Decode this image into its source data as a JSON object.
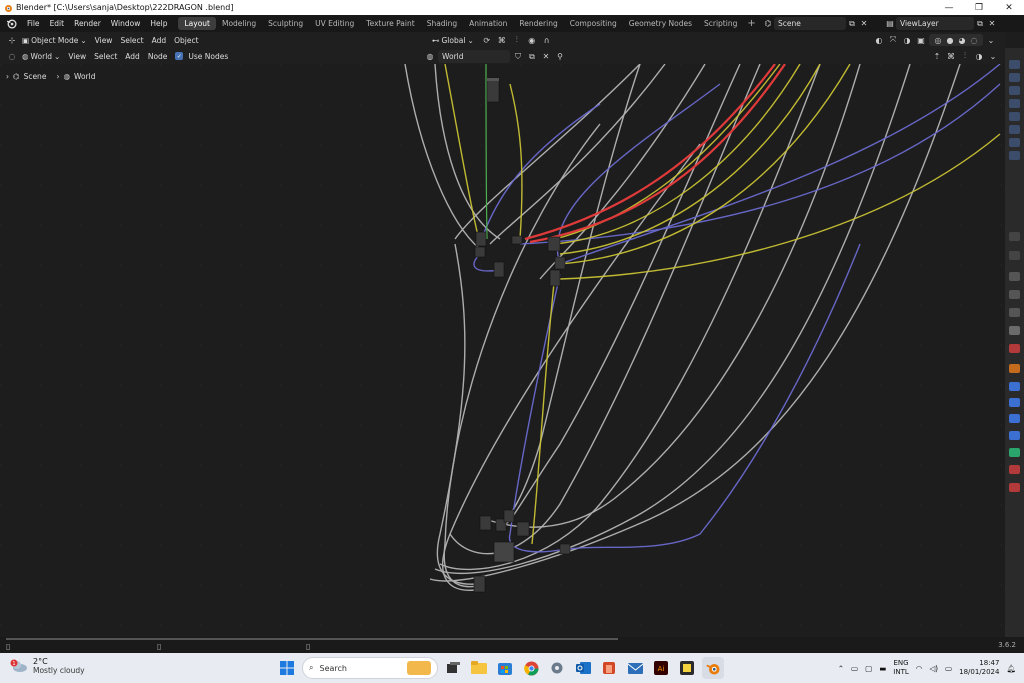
{
  "window": {
    "title": "Blender* [C:\\Users\\sanja\\Desktop\\222DRAGON .blend]",
    "controls": [
      "minimize-icon",
      "maximize-icon",
      "close-icon"
    ]
  },
  "menus": [
    "File",
    "Edit",
    "Render",
    "Window",
    "Help"
  ],
  "workspaces": {
    "tabs": [
      "Layout",
      "Modeling",
      "Sculpting",
      "UV Editing",
      "Texture Paint",
      "Shading",
      "Animation",
      "Rendering",
      "Compositing",
      "Geometry Nodes",
      "Scripting"
    ],
    "active": "Layout"
  },
  "scene": {
    "name": "Scene"
  },
  "view_layer": {
    "name": "ViewLayer"
  },
  "editor_header": {
    "mode": "Object Mode",
    "view": "View",
    "select": "Select",
    "add": "Add",
    "object": "Object",
    "orientation": "Global"
  },
  "node_header": {
    "shader_type": "World",
    "view": "View",
    "select": "Select",
    "add": "Add",
    "node": "Node",
    "use_nodes_label": "Use Nodes",
    "use_nodes_checked": true,
    "world_name": "World"
  },
  "breadcrumb": {
    "scene": "Scene",
    "world": "World"
  },
  "status": {
    "version": "3.6.2"
  },
  "taskbar": {
    "weather_temp": "2°C",
    "weather_desc": "Mostly cloudy",
    "weather_badge": "1",
    "search_placeholder": "Search",
    "lang_top": "ENG",
    "lang_bottom": "INTL",
    "time": "18:47",
    "date": "18/01/2024"
  },
  "colors": {
    "accent": "#4772b3",
    "link_red": "#e03a3a",
    "link_yellow": "#c9c234",
    "link_grey": "#bdbdbd",
    "link_purple": "#6464c8",
    "link_green": "#4fb04f"
  }
}
